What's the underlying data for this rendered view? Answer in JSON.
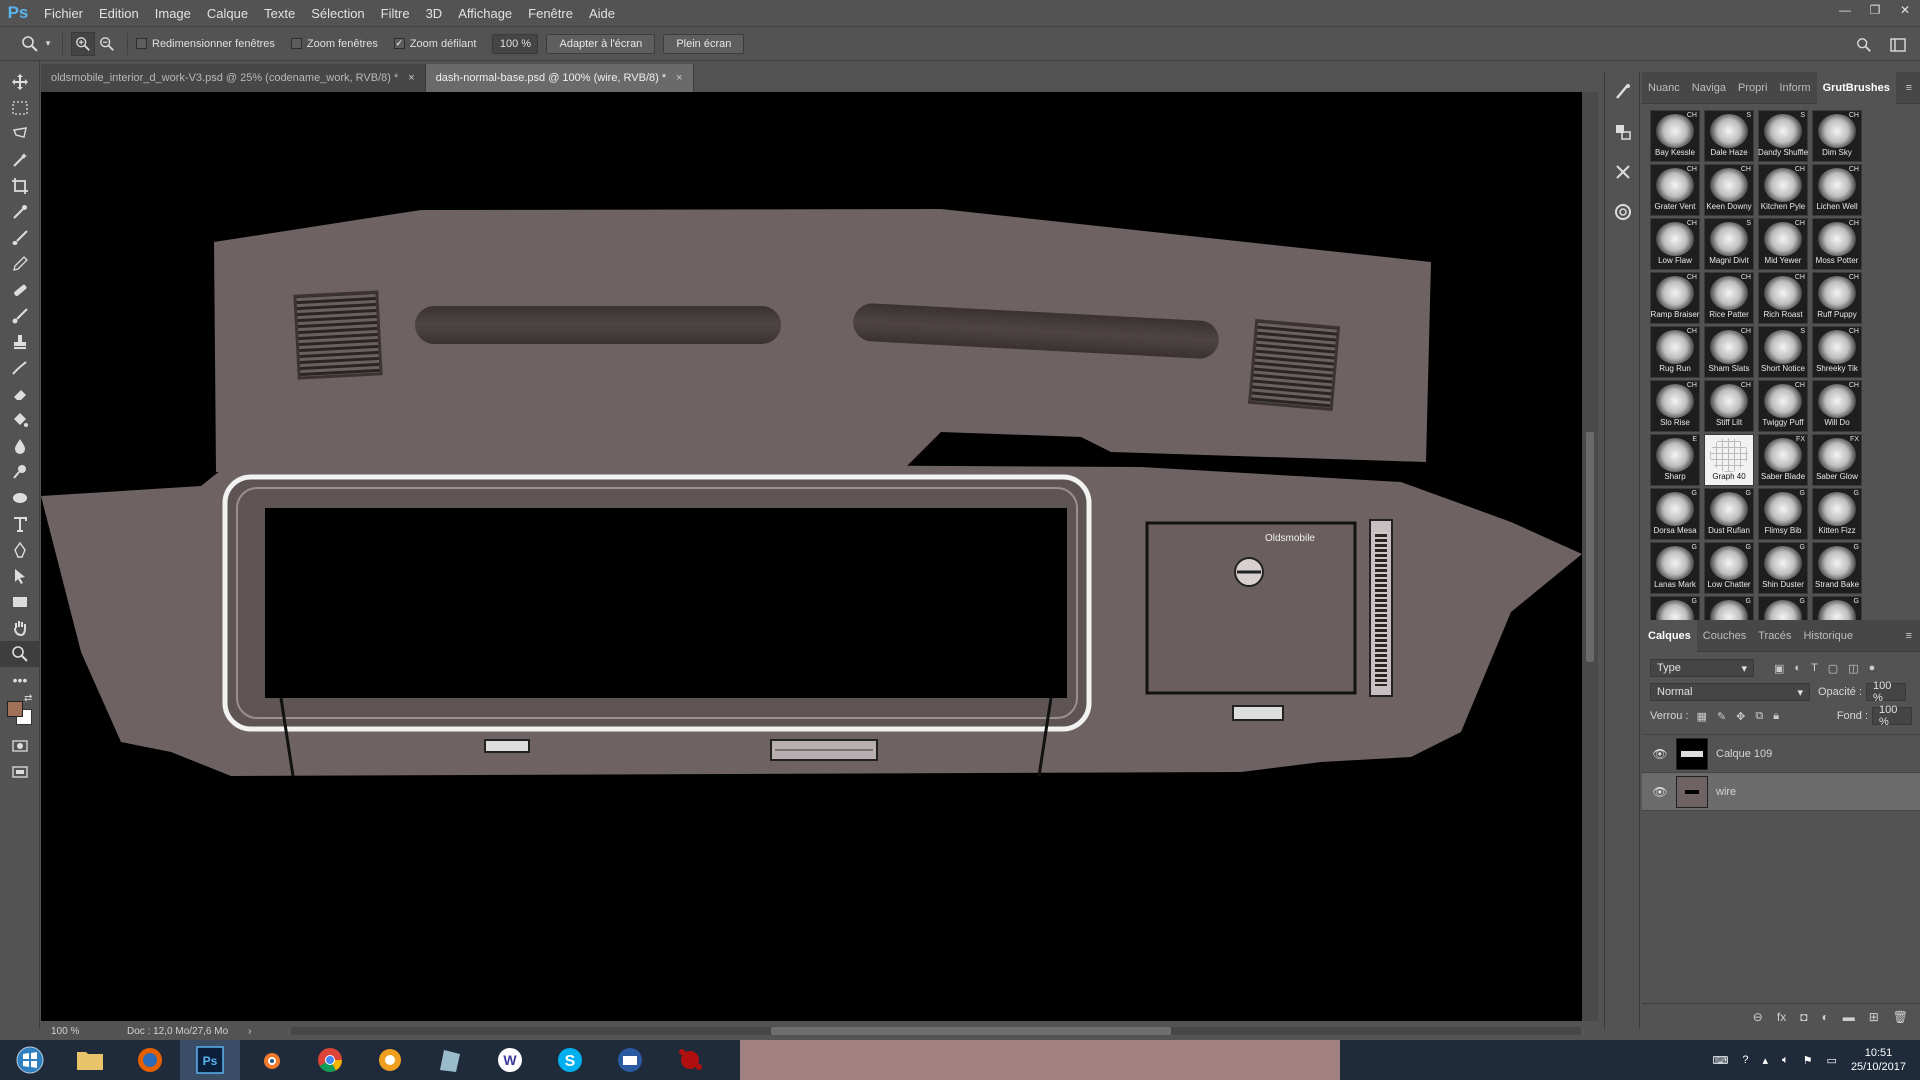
{
  "app": {
    "logo": "Ps"
  },
  "menu": [
    "Fichier",
    "Edition",
    "Image",
    "Calque",
    "Texte",
    "Sélection",
    "Filtre",
    "3D",
    "Affichage",
    "Fenêtre",
    "Aide"
  ],
  "options": {
    "resize_windows": "Redimensionner fenêtres",
    "zoom_all": "Zoom fenêtres",
    "scrubby": "Zoom défilant",
    "zoom_value": "100 %",
    "fit_screen": "Adapter à l'écran",
    "full_screen": "Plein écran"
  },
  "tabs": [
    {
      "label": "oldsmobile_interior_d_work-V3.psd @ 25% (codename_work, RVB/8) *",
      "close": "×"
    },
    {
      "label": "dash-normal-base.psd @ 100% (wire, RVB/8) *",
      "close": "×"
    }
  ],
  "canvas": {
    "label": "Oldsmobile"
  },
  "status": {
    "zoom": "100 %",
    "doc": "Doc : 12,0 Mo/27,6 Mo"
  },
  "top_panel_tabs": [
    "Nuanc",
    "Naviga",
    "Propri",
    "Inform",
    "GrutBrushes"
  ],
  "brushes": [
    {
      "name": "Bay Kessle",
      "tag": "CH"
    },
    {
      "name": "Dale Haze",
      "tag": "S"
    },
    {
      "name": "Dandy Shuffle",
      "tag": "S"
    },
    {
      "name": "Dim Sky",
      "tag": "CH"
    },
    {
      "name": "Grater Vent",
      "tag": "CH"
    },
    {
      "name": "Keen Downy",
      "tag": "CH"
    },
    {
      "name": "Kitchen Pyle",
      "tag": "CH"
    },
    {
      "name": "Lichen Well",
      "tag": "CH"
    },
    {
      "name": "Low Flaw",
      "tag": "CH"
    },
    {
      "name": "Magni Divit",
      "tag": "S"
    },
    {
      "name": "Mid Yewer",
      "tag": "CH"
    },
    {
      "name": "Moss Potter",
      "tag": "CH"
    },
    {
      "name": "Ramp Braiser",
      "tag": "CH"
    },
    {
      "name": "Rice Patter",
      "tag": "CH"
    },
    {
      "name": "Rich Roast",
      "tag": "CH"
    },
    {
      "name": "Ruff Puppy",
      "tag": "CH"
    },
    {
      "name": "Rug Run",
      "tag": "CH"
    },
    {
      "name": "Sham Slats",
      "tag": "CH"
    },
    {
      "name": "Short Notice",
      "tag": "S"
    },
    {
      "name": "Shreeky Tik",
      "tag": "CH"
    },
    {
      "name": "Slo Rise",
      "tag": "CH"
    },
    {
      "name": "Stiff Lilt",
      "tag": "CH"
    },
    {
      "name": "Twiggy Puff",
      "tag": "CH"
    },
    {
      "name": "Will Do",
      "tag": "CH"
    },
    {
      "name": "Sharp",
      "tag": "E"
    },
    {
      "name": "Graph 40",
      "tag": ""
    },
    {
      "name": "Saber Blade",
      "tag": "FX"
    },
    {
      "name": "Saber Glow",
      "tag": "FX"
    },
    {
      "name": "Dorsa Mesa",
      "tag": "G"
    },
    {
      "name": "Dust Rufian",
      "tag": "G"
    },
    {
      "name": "Flimsy Bib",
      "tag": "G"
    },
    {
      "name": "Kitten Fizz",
      "tag": "G"
    },
    {
      "name": "Lanas Mark",
      "tag": "G"
    },
    {
      "name": "Low Chatter",
      "tag": "G"
    },
    {
      "name": "Shin Duster",
      "tag": "G"
    },
    {
      "name": "Strand Bake",
      "tag": "G"
    },
    {
      "name": "",
      "tag": "G"
    },
    {
      "name": "",
      "tag": "G"
    },
    {
      "name": "",
      "tag": "G"
    },
    {
      "name": "",
      "tag": "G"
    }
  ],
  "layers_panel": {
    "tabs": [
      "Calques",
      "Couches",
      "Tracés",
      "Historique"
    ],
    "filter": "Type",
    "blend": "Normal",
    "opacity_label": "Opacité :",
    "opacity": "100 %",
    "lock_label": "Verrou :",
    "fill_label": "Fond :",
    "fill": "100 %",
    "layers": [
      {
        "name": "Calque 109"
      },
      {
        "name": "wire"
      }
    ]
  },
  "clock": {
    "time": "10:51",
    "date": "25/10/2017"
  }
}
